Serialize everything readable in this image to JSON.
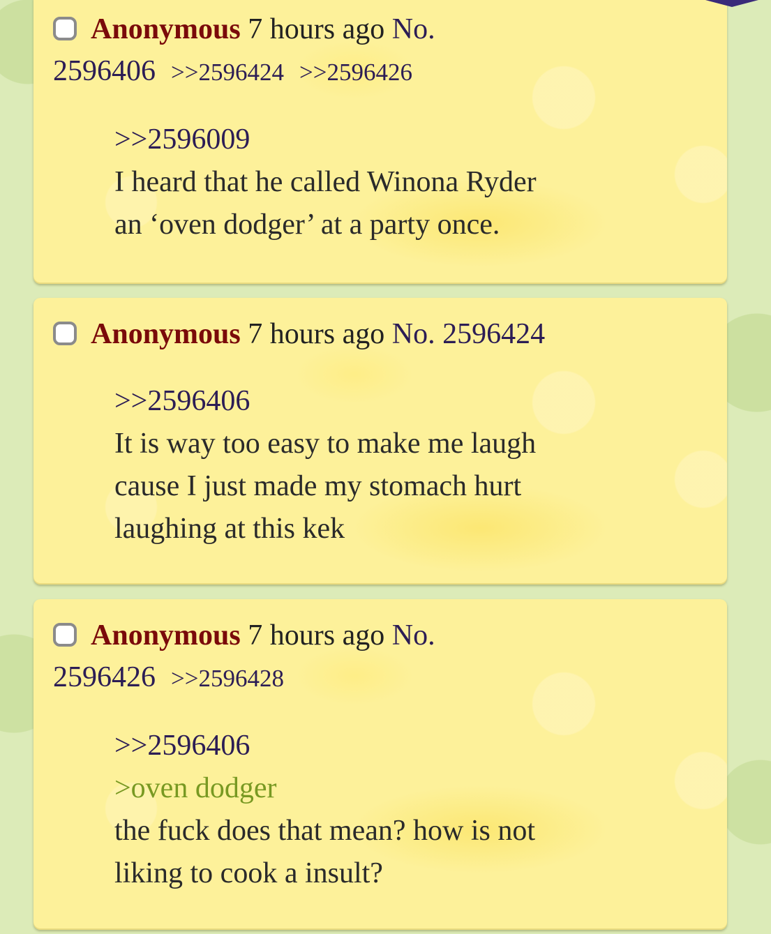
{
  "posts": [
    {
      "name": "Anonymous",
      "time": "7 hours ago",
      "no_prefix": "No.",
      "no": "2596406",
      "backlinks": [
        ">>2596424",
        ">>2596426"
      ],
      "quote": ">>2596009",
      "greentext": null,
      "lines": [
        "I heard that he called Winona Ryder",
        "an ‘oven dodger’ at a party once."
      ]
    },
    {
      "name": "Anonymous",
      "time": "7 hours ago",
      "no_prefix": "No.",
      "no": "2596424",
      "backlinks": [],
      "quote": ">>2596406",
      "greentext": null,
      "lines": [
        "It is way too easy to make me laugh",
        "cause I just made my stomach hurt",
        "laughing at this kek"
      ]
    },
    {
      "name": "Anonymous",
      "time": "7 hours ago",
      "no_prefix": "No.",
      "no": "2596426",
      "backlinks": [
        ">>2596428"
      ],
      "quote": ">>2596406",
      "greentext": ">oven dodger",
      "lines": [
        "the fuck does that mean? how is not",
        "liking to cook a insult?"
      ]
    }
  ],
  "colors": {
    "page_bg": "#dcebb8",
    "post_bg": "#fdf19a",
    "name": "#7a0a0a",
    "link": "#2c1d55",
    "greentext": "#789922"
  }
}
